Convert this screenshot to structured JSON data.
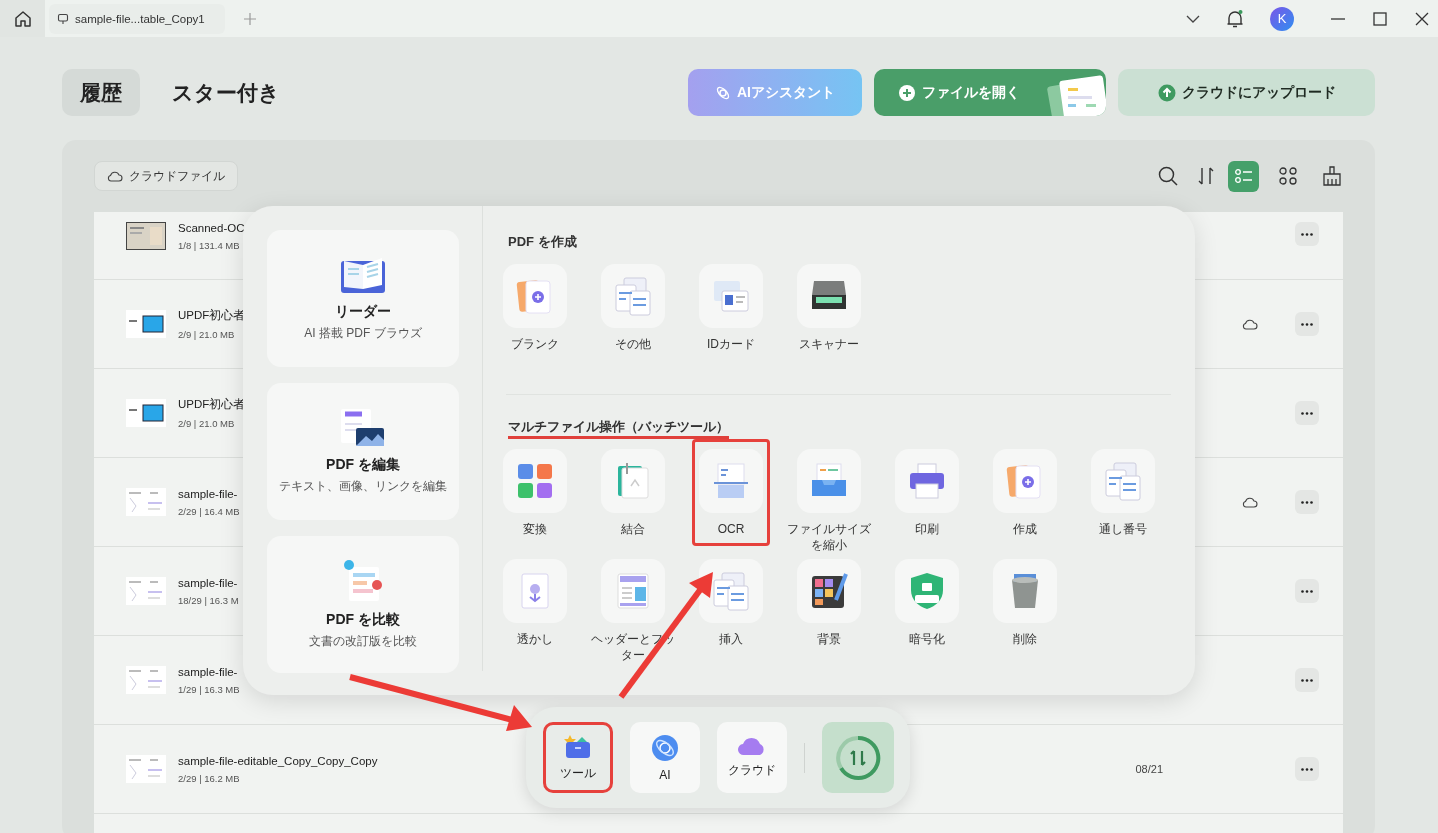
{
  "window": {
    "tab": "sample-file...table_Copy1",
    "avatar": "K"
  },
  "header": {
    "tabs": [
      {
        "label": "履歴",
        "selected": true
      },
      {
        "label": "スター付き",
        "selected": false
      }
    ],
    "buttons": [
      {
        "label": "AIアシスタント",
        "kind": "ai"
      },
      {
        "label": "ファイルを開く",
        "kind": "open"
      },
      {
        "label": "クラウドにアップロード",
        "kind": "upload"
      }
    ]
  },
  "toolbar": {
    "cloud_files": "クラウドファイル",
    "view_modes": [
      {
        "selected": true
      },
      {
        "selected": false
      }
    ]
  },
  "files": [
    {
      "name": "Scanned-OC",
      "meta": "1/8 | 131.4 MB",
      "cloud": false,
      "kind": "scan"
    },
    {
      "name": "UPDF初心者",
      "meta": "2/9 | 21.0 MB",
      "cloud": true,
      "kind": "slide"
    },
    {
      "name": "UPDF初心者",
      "meta": "2/9 | 21.0 MB",
      "cloud": false,
      "kind": "slide"
    },
    {
      "name": "sample-file-",
      "meta": "2/29 | 16.4 MB",
      "cloud": true,
      "kind": "doc"
    },
    {
      "name": "sample-file-",
      "meta": "18/29 | 16.3 M",
      "cloud": false,
      "kind": "doc"
    },
    {
      "name": "sample-file-",
      "meta": "1/29 | 16.3 MB",
      "cloud": false,
      "kind": "doc"
    },
    {
      "name": "sample-file-editable_Copy_Copy_Copy",
      "meta": "2/29 | 16.2 MB",
      "date": "08/21",
      "cloud": false,
      "kind": "doc"
    }
  ],
  "tools_popup": {
    "cards": [
      {
        "title": "リーダー",
        "subtitle": "AI 搭載 PDF ブラウズ"
      },
      {
        "title": "PDF を編集",
        "subtitle": "テキスト、画像、リンクを編集"
      },
      {
        "title": "PDF を比較",
        "subtitle": "文書の改訂版を比較"
      }
    ],
    "sections": [
      {
        "heading": "PDF を作成",
        "underlined": false,
        "tools": [
          {
            "label": "ブランク",
            "highlighted": false
          },
          {
            "label": "その他",
            "highlighted": false
          },
          {
            "label": "IDカード",
            "highlighted": false
          },
          {
            "label": "スキャナー",
            "highlighted": false
          }
        ]
      },
      {
        "heading": "マルチファイル操作（バッチツール）",
        "underlined": true,
        "tools": [
          {
            "label": "変換",
            "highlighted": false
          },
          {
            "label": "結合",
            "highlighted": false
          },
          {
            "label": "OCR",
            "highlighted": true
          },
          {
            "label": "ファイルサイズを縮小",
            "highlighted": false
          },
          {
            "label": "印刷",
            "highlighted": false
          },
          {
            "label": "作成",
            "highlighted": false
          },
          {
            "label": "通し番号",
            "highlighted": false
          },
          {
            "label": "透かし",
            "highlighted": false
          },
          {
            "label": "ヘッダーとフッター",
            "highlighted": false
          },
          {
            "label": "挿入",
            "highlighted": false
          },
          {
            "label": "背景",
            "highlighted": false
          },
          {
            "label": "暗号化",
            "highlighted": false
          },
          {
            "label": "削除",
            "highlighted": false
          }
        ]
      }
    ]
  },
  "dock": {
    "items": [
      {
        "label": "ツール",
        "highlighted": true
      },
      {
        "label": "AI",
        "highlighted": false
      },
      {
        "label": "クラウド",
        "highlighted": false
      }
    ]
  }
}
